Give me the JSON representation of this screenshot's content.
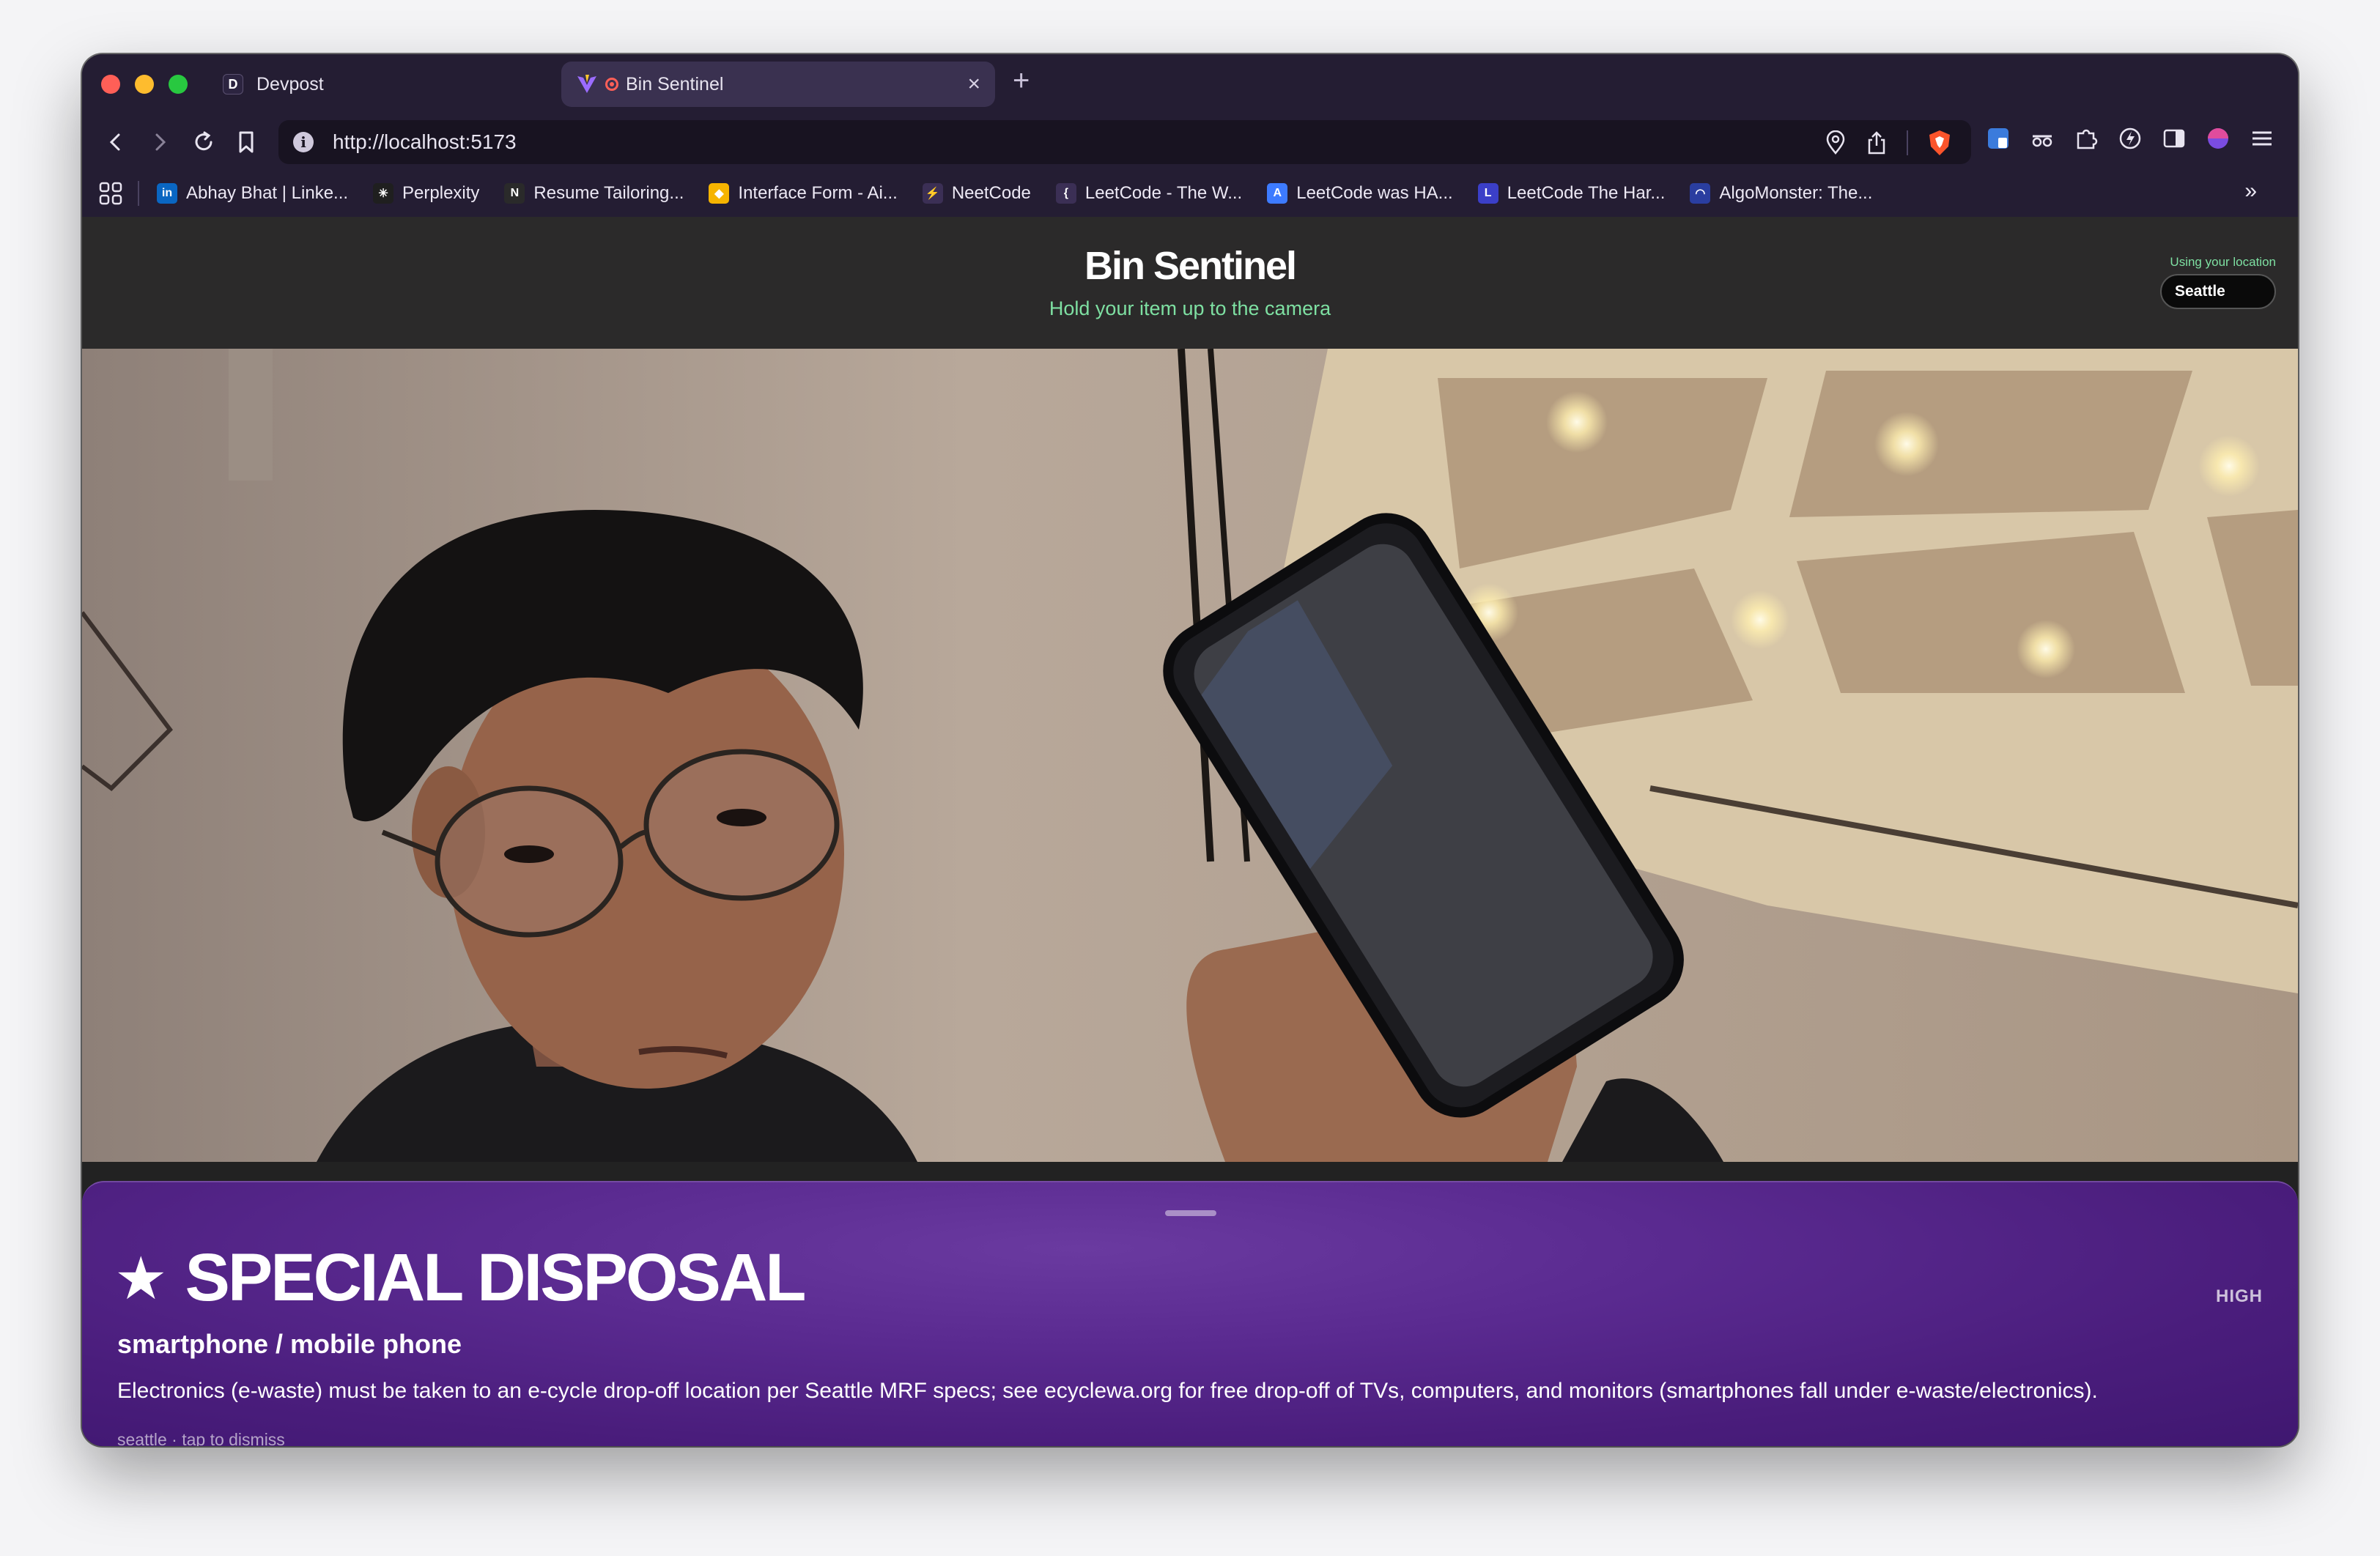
{
  "browser": {
    "tabs": [
      {
        "label": "Devpost",
        "icon": "devpost-icon",
        "active": false
      },
      {
        "label": "Bin Sentinel",
        "icon": "vite-icon",
        "active": true
      }
    ],
    "url": "http://localhost:5173",
    "bookmarks": [
      {
        "label": "Abhay Bhat | Linke...",
        "icon": "linkedin-icon",
        "color": "#0a66c2",
        "glyph": "in"
      },
      {
        "label": "Perplexity",
        "icon": "perplexity-icon",
        "color": "#1f1f1f",
        "glyph": "✳"
      },
      {
        "label": "Resume Tailoring...",
        "icon": "notion-icon",
        "color": "#2a2a2a",
        "glyph": "N"
      },
      {
        "label": "Interface Form - Ai...",
        "icon": "airtable-icon",
        "color": "#f6b400",
        "glyph": "◆"
      },
      {
        "label": "NeetCode",
        "icon": "neetcode-icon",
        "color": "#3b2f55",
        "glyph": "⚡"
      },
      {
        "label": "LeetCode - The W...",
        "icon": "leetcode-icon",
        "color": "#3b2f55",
        "glyph": "{"
      },
      {
        "label": "LeetCode was HA...",
        "icon": "a-icon",
        "color": "#3d7bff",
        "glyph": "A"
      },
      {
        "label": "LeetCode The Har...",
        "icon": "l-icon",
        "color": "#3b3fc8",
        "glyph": "L"
      },
      {
        "label": "AlgoMonster: The...",
        "icon": "algomonster-icon",
        "color": "#2a3ea0",
        "glyph": "◠"
      }
    ]
  },
  "app": {
    "title": "Bin Sentinel",
    "subtitle": "Hold your item up to the camera",
    "location_label": "Using your location",
    "location_value": "Seattle"
  },
  "result": {
    "category": "SPECIAL DISPOSAL",
    "confidence": "HIGH",
    "item": "smartphone / mobile phone",
    "description": "Electronics (e-waste) must be taken to an e-cycle drop-off location per Seattle MRF specs; see ecyclewa.org for free drop-off of TVs, computers, and monitors (smartphones fall under e-waste/electronics).",
    "footer": "seattle · tap to dismiss"
  },
  "colors": {
    "sheet": "#4a1d7c",
    "accent_green": "#7ee0a2"
  }
}
